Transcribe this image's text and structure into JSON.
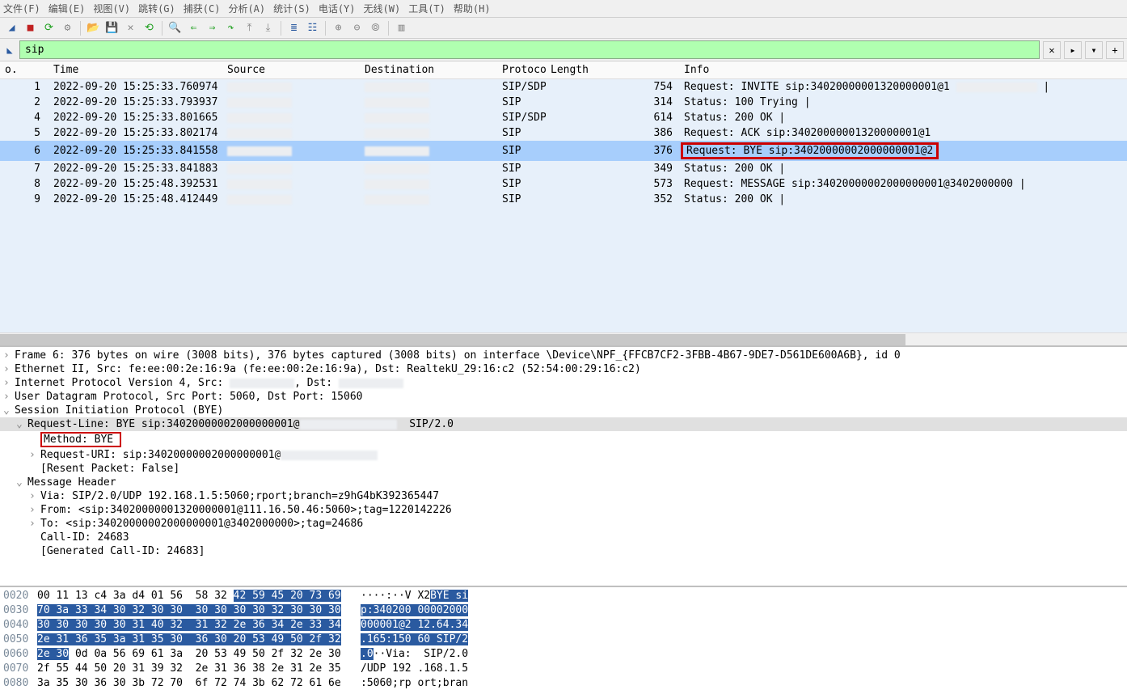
{
  "menu": {
    "file": "文件(F)",
    "edit": "编辑(E)",
    "view": "视图(V)",
    "goto": "跳转(G)",
    "capture": "捕获(C)",
    "analyze": "分析(A)",
    "statistics": "统计(S)",
    "telephony": "电话(Y)",
    "wireless": "无线(W)",
    "tools": "工具(T)",
    "help": "帮助(H)"
  },
  "filter": {
    "value": "sip",
    "clear_glyph": "✕",
    "apply_glyph": "▸",
    "history_glyph": "▾",
    "add_glyph": "+"
  },
  "columns": {
    "no": "o.",
    "time": "Time",
    "source": "Source",
    "destination": "Destination",
    "protocol": "Protocol",
    "length": "Length",
    "info": "Info"
  },
  "packets": [
    {
      "no": "1",
      "time": "2022-09-20 15:25:33.760974",
      "proto": "SIP/SDP",
      "len": "754",
      "info": "Request: INVITE sip:34020000001320000001@1",
      "trail": "|"
    },
    {
      "no": "2",
      "time": "2022-09-20 15:25:33.793937",
      "proto": "SIP",
      "len": "314",
      "info": "Status: 100 Trying  |",
      "trail": ""
    },
    {
      "no": "4",
      "time": "2022-09-20 15:25:33.801665",
      "proto": "SIP/SDP",
      "len": "614",
      "info": "Status: 200 OK  |",
      "trail": ""
    },
    {
      "no": "5",
      "time": "2022-09-20 15:25:33.802174",
      "proto": "SIP",
      "len": "386",
      "info": "Request: ACK sip:34020000001320000001@1",
      "trail": ""
    },
    {
      "no": "6",
      "time": "2022-09-20 15:25:33.841558",
      "proto": "SIP",
      "len": "376",
      "info": "Request: BYE sip:34020000002000000001@2",
      "trail": "",
      "selected": true,
      "highlight": true
    },
    {
      "no": "7",
      "time": "2022-09-20 15:25:33.841883",
      "proto": "SIP",
      "len": "349",
      "info": "Status: 200 OK  |",
      "trail": ""
    },
    {
      "no": "8",
      "time": "2022-09-20 15:25:48.392531",
      "proto": "SIP",
      "len": "573",
      "info": "Request: MESSAGE sip:34020000002000000001@3402000000  |",
      "trail": ""
    },
    {
      "no": "9",
      "time": "2022-09-20 15:25:48.412449",
      "proto": "SIP",
      "len": "352",
      "info": "Status: 200 OK  |",
      "trail": ""
    }
  ],
  "detail": {
    "frame": "Frame 6: 376 bytes on wire (3008 bits), 376 bytes captured (3008 bits) on interface \\Device\\NPF_{FFCB7CF2-3FBB-4B67-9DE7-D561DE600A6B}, id 0",
    "eth": "Ethernet II, Src: fe:ee:00:2e:16:9a (fe:ee:00:2e:16:9a), Dst: RealtekU_29:16:c2 (52:54:00:29:16:c2)",
    "ip_pre": "Internet Protocol Version 4, Src: ",
    "ip_mid": ", Dst: ",
    "udp": "User Datagram Protocol, Src Port: 5060, Dst Port: 15060",
    "sip": "Session Initiation Protocol (BYE)",
    "reqline_pre": "Request-Line: BYE sip:34020000002000000001@",
    "reqline_suf": "SIP/2.0",
    "method": "Method: BYE",
    "requri": "Request-URI: sip:34020000002000000001@",
    "resent": "[Resent Packet: False]",
    "msghdr": "Message Header",
    "via": "Via: SIP/2.0/UDP 192.168.1.5:5060;rport;branch=z9hG4bK392365447",
    "from": "From: <sip:34020000001320000001@111.16.50.46:5060>;tag=1220142226",
    "to": "To: <sip:34020000002000000001@3402000000>;tag=24686",
    "callid": "Call-ID: 24683",
    "gencallid": "[Generated Call-ID: 24683]"
  },
  "hex": [
    {
      "off": "0020",
      "plain_a": "00 11 13 c4 3a d4 01 56  58 32 ",
      "sel_a": "42 59 45 20 73 69",
      "ascii_plain": "····:··V X2",
      "ascii_sel": "BYE si"
    },
    {
      "off": "0030",
      "plain_a": "",
      "sel_a": "70 3a 33 34 30 32 30 30  30 30 30 30 32 30 30 30",
      "ascii_plain": "",
      "ascii_sel": "p:340200 00002000"
    },
    {
      "off": "0040",
      "plain_a": "",
      "sel_a": "30 30 30 30 30 31 40 32  31 32 2e 36 34 2e 33 34",
      "ascii_plain": "",
      "ascii_sel": "000001@2 12.64.34"
    },
    {
      "off": "0050",
      "plain_a": "",
      "sel_a": "2e 31 36 35 3a 31 35 30  36 30 20 53 49 50 2f 32",
      "ascii_plain": "",
      "ascii_sel": ".165:150 60 SIP/2"
    },
    {
      "off": "0060",
      "plain_a": "",
      "sel_a": "2e 30",
      "sel_b": "",
      "plain_b": "0d 0a 56 69 61 3a  20 53 49 50 2f 32 2e 30",
      "ascii_sel": ".0",
      "ascii_plain_b": "··Via:  SIP/2.0"
    },
    {
      "off": "0070",
      "plain_a": "2f 55 44 50 20 31 39 32  2e 31 36 38 2e 31 2e 35",
      "sel_a": "",
      "ascii_plain": "/UDP 192 .168.1.5",
      "ascii_sel": ""
    },
    {
      "off": "0080",
      "plain_a": "3a 35 30 36 30 3b 72 70  6f 72 74 3b 62 72 61 6e",
      "sel_a": "",
      "ascii_plain": ":5060;rp ort;bran",
      "ascii_sel": ""
    }
  ]
}
